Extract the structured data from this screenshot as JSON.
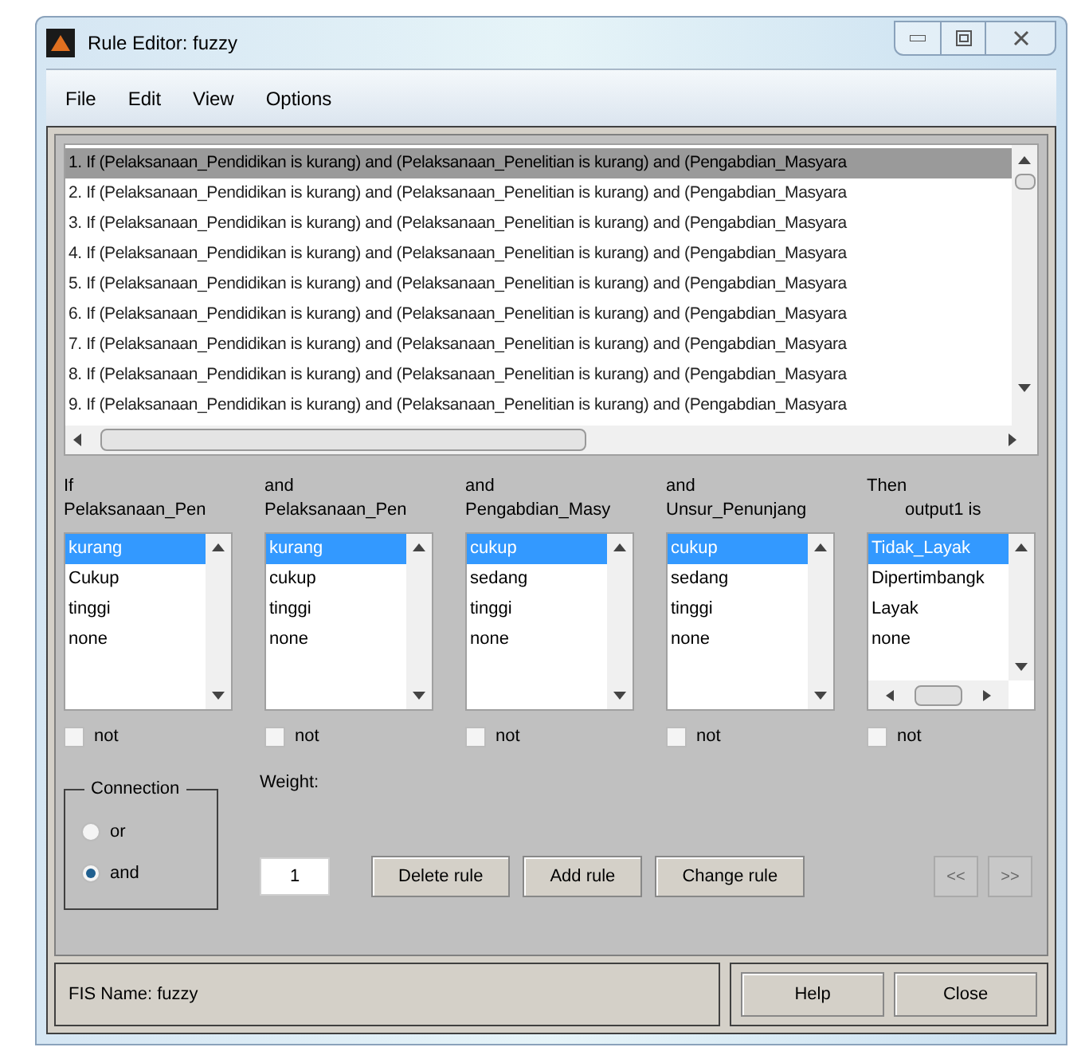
{
  "window": {
    "title": "Rule Editor: fuzzy"
  },
  "menu": [
    "File",
    "Edit",
    "View",
    "Options"
  ],
  "rules": [
    {
      "text": "1. If (Pelaksanaan_Pendidikan is kurang) and (Pelaksanaan_Penelitian is kurang) and (Pengabdian_Masyara",
      "selected": true
    },
    {
      "text": "2. If (Pelaksanaan_Pendidikan is kurang) and (Pelaksanaan_Penelitian is kurang) and (Pengabdian_Masyara",
      "selected": false
    },
    {
      "text": "3. If (Pelaksanaan_Pendidikan is kurang) and (Pelaksanaan_Penelitian is kurang) and (Pengabdian_Masyara",
      "selected": false
    },
    {
      "text": "4. If (Pelaksanaan_Pendidikan is kurang) and (Pelaksanaan_Penelitian is kurang) and (Pengabdian_Masyara",
      "selected": false
    },
    {
      "text": "5. If (Pelaksanaan_Pendidikan is kurang) and (Pelaksanaan_Penelitian is kurang) and (Pengabdian_Masyara",
      "selected": false
    },
    {
      "text": "6. If (Pelaksanaan_Pendidikan is kurang) and (Pelaksanaan_Penelitian is kurang) and (Pengabdian_Masyara",
      "selected": false
    },
    {
      "text": "7. If (Pelaksanaan_Pendidikan is kurang) and (Pelaksanaan_Penelitian is kurang) and (Pengabdian_Masyara",
      "selected": false
    },
    {
      "text": "8. If (Pelaksanaan_Pendidikan is kurang) and (Pelaksanaan_Penelitian is kurang) and (Pengabdian_Masyara",
      "selected": false
    },
    {
      "text": "9. If (Pelaksanaan_Pendidikan is kurang) and (Pelaksanaan_Penelitian is kurang) and (Pengabdian_Masyara",
      "selected": false
    }
  ],
  "columns": [
    {
      "prefix": "If",
      "variable": "Pelaksanaan_Pen",
      "not": false,
      "not_label": "not",
      "items": [
        {
          "label": "kurang",
          "selected": true
        },
        {
          "label": "Cukup",
          "selected": false
        },
        {
          "label": "tinggi",
          "selected": false
        },
        {
          "label": "none",
          "selected": false
        }
      ]
    },
    {
      "prefix": "and",
      "variable": "Pelaksanaan_Pen",
      "not": false,
      "not_label": "not",
      "items": [
        {
          "label": "kurang",
          "selected": true
        },
        {
          "label": "cukup",
          "selected": false
        },
        {
          "label": "tinggi",
          "selected": false
        },
        {
          "label": "none",
          "selected": false
        }
      ]
    },
    {
      "prefix": "and",
      "variable": "Pengabdian_Masy",
      "not": false,
      "not_label": "not",
      "items": [
        {
          "label": "cukup",
          "selected": true
        },
        {
          "label": "sedang",
          "selected": false
        },
        {
          "label": "tinggi",
          "selected": false
        },
        {
          "label": "none",
          "selected": false
        }
      ]
    },
    {
      "prefix": "and",
      "variable": "Unsur_Penunjang",
      "not": false,
      "not_label": "not",
      "items": [
        {
          "label": "cukup",
          "selected": true
        },
        {
          "label": "sedang",
          "selected": false
        },
        {
          "label": "tinggi",
          "selected": false
        },
        {
          "label": "none",
          "selected": false
        }
      ]
    },
    {
      "prefix": "Then",
      "variable": "output1 is",
      "not": false,
      "not_label": "not",
      "items": [
        {
          "label": "Tidak_Layak",
          "selected": true
        },
        {
          "label": "Dipertimbangk",
          "selected": false
        },
        {
          "label": "Layak",
          "selected": false
        },
        {
          "label": "none",
          "selected": false
        }
      ]
    }
  ],
  "connection": {
    "title": "Connection",
    "options": [
      {
        "label": "or",
        "selected": false
      },
      {
        "label": "and",
        "selected": true
      }
    ]
  },
  "weight": {
    "label": "Weight:",
    "value": "1"
  },
  "buttons": [
    "Delete rule",
    "Add rule",
    "Change rule"
  ],
  "nav_buttons": [
    {
      "label": "<<",
      "disabled": true
    },
    {
      "label": ">>",
      "disabled": true
    }
  ],
  "status": "FIS Name: fuzzy",
  "footer_buttons": [
    "Help",
    "Close"
  ]
}
